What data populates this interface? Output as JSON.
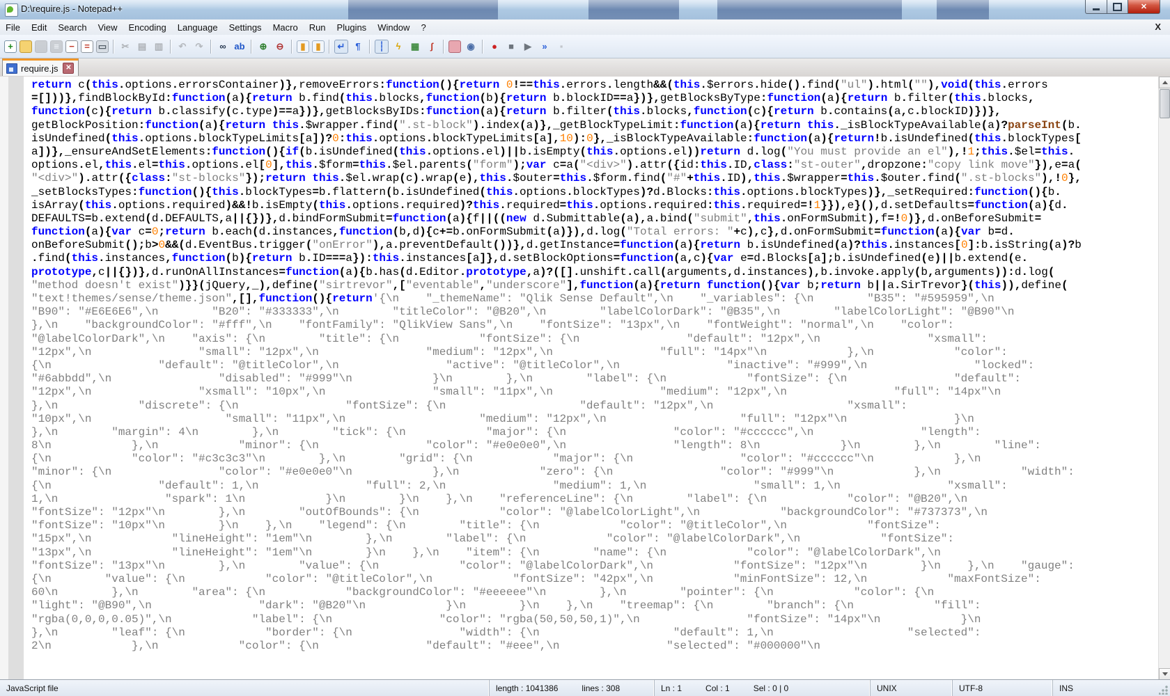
{
  "window": {
    "title": "D:\\require.js - Notepad++",
    "controls": {
      "minimize": "minimize",
      "maximize": "maximize",
      "close": "close"
    }
  },
  "menu": {
    "items": [
      "File",
      "Edit",
      "Search",
      "View",
      "Encoding",
      "Language",
      "Settings",
      "Macro",
      "Run",
      "Plugins",
      "Window",
      "?"
    ],
    "close_label": "X"
  },
  "toolbar": {
    "icons": [
      {
        "name": "new-file-button",
        "glyph": "+",
        "fg": "#1d8a1d",
        "bg": "#ffffff",
        "border": "#7a93a8"
      },
      {
        "name": "open-file-button",
        "glyph": "",
        "fg": "#6b5310",
        "bg": "#f5d271",
        "border": "#c19a35"
      },
      {
        "name": "save-file-button",
        "glyph": "",
        "fg": "#ffffff",
        "bg": "#a9afb6",
        "border": "#8d949c",
        "disabled": true
      },
      {
        "name": "save-all-button",
        "glyph": "≡",
        "fg": "#ffffff",
        "bg": "#a9afb6",
        "border": "#8d949c",
        "disabled": true
      },
      {
        "name": "close-file-button",
        "glyph": "−",
        "fg": "#c23b2a",
        "bg": "#ffffff",
        "border": "#8d949c"
      },
      {
        "name": "close-all-button",
        "glyph": "=",
        "fg": "#c23b2a",
        "bg": "#ffffff",
        "border": "#8d949c"
      },
      {
        "name": "print-button",
        "glyph": "▭",
        "fg": "#555f69",
        "bg": "#d7dde4",
        "border": "#9aa2ab",
        "sep_after": true
      },
      {
        "name": "cut-button",
        "glyph": "✂",
        "fg": "#6d747c",
        "disabled": true
      },
      {
        "name": "copy-button",
        "glyph": "▤",
        "fg": "#6d747c",
        "disabled": true
      },
      {
        "name": "paste-button",
        "glyph": "▥",
        "fg": "#6d747c",
        "disabled": true,
        "sep_after": true
      },
      {
        "name": "undo-button",
        "glyph": "↶",
        "fg": "#7d858e",
        "disabled": true
      },
      {
        "name": "redo-button",
        "glyph": "↷",
        "fg": "#7d858e",
        "disabled": true,
        "sep_after": true
      },
      {
        "name": "find-button",
        "glyph": "∞",
        "fg": "#24354d"
      },
      {
        "name": "replace-button",
        "glyph": "ab",
        "fg": "#1f56c9",
        "sep_after": true
      },
      {
        "name": "zoom-in-button",
        "glyph": "⊕",
        "fg": "#2b7d2b"
      },
      {
        "name": "zoom-out-button",
        "glyph": "⊖",
        "fg": "#b03434",
        "sep_after": true
      },
      {
        "name": "sync-vertical-button",
        "glyph": "▮",
        "fg": "#e39a21",
        "bg": "#f2f6fb",
        "border": "#9fb0c4"
      },
      {
        "name": "sync-horizontal-button",
        "glyph": "▮",
        "fg": "#e39a21",
        "bg": "#f2f6fb",
        "border": "#9fb0c4",
        "sep_after": true
      },
      {
        "name": "word-wrap-button",
        "glyph": "↵",
        "fg": "#2b5fd9",
        "pressed": true
      },
      {
        "name": "show-all-chars-button",
        "glyph": "¶",
        "fg": "#2b5fd9",
        "sep_after": true
      },
      {
        "name": "indent-guide-button",
        "glyph": "┆",
        "fg": "#2b5fd9",
        "pressed": true
      },
      {
        "name": "function-list-button",
        "glyph": "ϟ",
        "fg": "#d9a404"
      },
      {
        "name": "document-map-button",
        "glyph": "▦",
        "fg": "#3f8a3f"
      },
      {
        "name": "run-script-button",
        "glyph": "ʃ",
        "fg": "#c03a2b",
        "sep_after": true
      },
      {
        "name": "project-panel-button",
        "glyph": "",
        "fg": "#7c3b44",
        "bg": "#e8a7b0",
        "border": "#b26773"
      },
      {
        "name": "preview-button",
        "glyph": "◉",
        "fg": "#4a6da7",
        "sep_after": true
      },
      {
        "name": "macro-record-button",
        "glyph": "●",
        "fg": "#cc2222"
      },
      {
        "name": "macro-stop-button",
        "glyph": "■",
        "fg": "#6e757d"
      },
      {
        "name": "macro-play-button",
        "glyph": "▶",
        "fg": "#6e757d"
      },
      {
        "name": "macro-run-multiple-button",
        "glyph": "»",
        "fg": "#2b5fd9"
      },
      {
        "name": "macro-save-button",
        "glyph": "▪",
        "fg": "#9aa0a6",
        "disabled": true
      }
    ]
  },
  "tab": {
    "label": "require.js",
    "close_glyph": "✕"
  },
  "editor": {
    "syntax": {
      "keywords": [
        "function",
        "return",
        "this",
        "var",
        "if",
        "new",
        "void",
        "class",
        "prototype"
      ],
      "builtin": "parseInt",
      "colors": {
        "keyword": "#0000ff",
        "string": "#808080",
        "number": "#ff8000",
        "builtin": "#8b4513",
        "default": "#000000"
      }
    },
    "lines": [
      "return c(this.options.errorsContainer)},removeErrors:function(){return 0!==this.errors.length&&(this.$errors.hide().find(\"ul\").html(\"\"),void(this.errors",
      "=[]))},findBlockById:function(a){return b.find(this.blocks,function(b){return b.blockID==a})},getBlocksByType:function(a){return b.filter(this.blocks,",
      "function(c){return b.classify(c.type)==a})},getBlocksByIDs:function(a){return b.filter(this.blocks,function(c){return b.contains(a,c.blockID)})},",
      "getBlockPosition:function(a){return this.$wrapper.find(\".st-block\").index(a)},_getBlockTypeLimit:function(a){return this._isBlockTypeAvailable(a)?parseInt(b.",
      "isUndefined(this.options.blockTypeLimits[a])?0:this.options.blockTypeLimits[a],10):0},_isBlockTypeAvailable:function(a){return!b.isUndefined(this.blockTypes[",
      "a])},_ensureAndSetElements:function(){if(b.isUndefined(this.options.el)||b.isEmpty(this.options.el))return d.log(\"You must provide an el\"),!1;this.$el=this.",
      "options.el,this.el=this.options.el[0],this.$form=this.$el.parents(\"form\");var c=a(\"<div>\").attr({id:this.ID,class:\"st-outer\",dropzone:\"copy link move\"}),e=a(",
      "\"<div>\").attr({class:\"st-blocks\"});return this.$el.wrap(c).wrap(e),this.$outer=this.$form.find(\"#\"+this.ID),this.$wrapper=this.$outer.find(\".st-blocks\"),!0},",
      "_setBlocksTypes:function(){this.blockTypes=b.flattern(b.isUndefined(this.options.blockTypes)?d.Blocks:this.options.blockTypes)},_setRequired:function(){b.",
      "isArray(this.options.required)&&!b.isEmpty(this.options.required)?this.required=this.options.required:this.required=!1}}),e}(),d.setDefaults=function(a){d.",
      "DEFAULTS=b.extend(d.DEFAULTS,a||{})},d.bindFormSubmit=function(a){f||((new d.Submittable(a),a.bind(\"submit\",this.onFormSubmit),f=!0)},d.onBeforeSubmit=",
      "function(a){var c=0;return b.each(d.instances,function(b,d){c+=b.onFormSubmit(a)}),d.log(\"Total errors: \"+c),c},d.onFormSubmit=function(a){var b=d.",
      "onBeforeSubmit();b>0&&(d.EventBus.trigger(\"onError\"),a.preventDefault())},d.getInstance=function(a){return b.isUndefined(a)?this.instances[0]:b.isString(a)?b",
      ".find(this.instances,function(b){return b.ID===a}):this.instances[a]},d.setBlockOptions=function(a,c){var e=d.Blocks[a];b.isUndefined(e)||b.extend(e.",
      "prototype,c||{})},d.runOnAllInstances=function(a){b.has(d.Editor.prototype,a)?([].unshift.call(arguments,d.instances),b.invoke.apply(b,arguments)):d.log(",
      "\"method doesn't exist\")}}(jQuery,_),define(\"sirtrevor\",[\"eventable\",\"underscore\"],function(a){return function(){var b;return b||a.SirTrevor}(this)),define(",
      "\"text!themes/sense/theme.json\",[],function(){return'{\\n    \"_themeName\": \"Qlik Sense Default\",\\n    \"_variables\": {\\n        \"B35\": \"#595959\",\\n",
      "\"B90\": \"#E6E6E6\",\\n        \"B20\": \"#333333\",\\n        \"titleColor\": \"@B20\",\\n        \"labelColorDark\": \"@B35\",\\n        \"labelColorLight\": \"@B90\"\\n",
      "},\\n    \"backgroundColor\": \"#fff\",\\n    \"fontFamily\": \"QlikView Sans\",\\n    \"fontSize\": \"13px\",\\n    \"fontWeight\": \"normal\",\\n    \"color\":",
      "\"@labelColorDark\",\\n    \"axis\": {\\n        \"title\": {\\n            \"fontSize\": {\\n                \"default\": \"12px\",\\n                \"xsmall\":",
      "\"12px\",\\n                \"small\": \"12px\",\\n                \"medium\": \"12px\",\\n                \"full\": \"14px\"\\n            },\\n            \"color\":",
      "{\\n                \"default\": \"@titleColor\",\\n                \"active\": \"@titleColor\",\\n                \"inactive\": \"#999\",\\n                \"locked\":",
      "\"#6abbdd\",\\n                \"disabled\": \"#999\"\\n            }\\n        },\\n        \"label\": {\\n            \"fontSize\": {\\n                \"default\":",
      "\"12px\",\\n                \"xsmall\": \"10px\",\\n                \"small\": \"11px\",\\n                \"medium\": \"12px\",\\n                \"full\": \"14px\"\\n",
      "},\\n            \"discrete\": {\\n                \"fontSize\": {\\n                    \"default\": \"12px\",\\n                    \"xsmall\":",
      "\"10px\",\\n                    \"small\": \"11px\",\\n                    \"medium\": \"12px\",\\n                    \"full\": \"12px\"\\n                }\\n",
      "},\\n        \"margin\": 4\\n        },\\n        \"tick\": {\\n            \"major\": {\\n                \"color\": \"#cccccc\",\\n                \"length\":",
      "8\\n            },\\n            \"minor\": {\\n                \"color\": \"#e0e0e0\",\\n                \"length\": 8\\n            }\\n        },\\n        \"line\":",
      "{\\n            \"color\": \"#c3c3c3\"\\n        },\\n        \"grid\": {\\n            \"major\": {\\n                \"color\": \"#cccccc\"\\n            },\\n",
      "\"minor\": {\\n                \"color\": \"#e0e0e0\"\\n            },\\n            \"zero\": {\\n                \"color\": \"#999\"\\n            },\\n            \"width\":",
      "{\\n                \"default\": 1,\\n                \"full\": 2,\\n                \"medium\": 1,\\n                \"small\": 1,\\n                \"xsmall\":",
      "1,\\n                \"spark\": 1\\n            }\\n        }\\n    },\\n    \"referenceLine\": {\\n        \"label\": {\\n            \"color\": \"@B20\",\\n",
      "\"fontSize\": \"12px\"\\n        },\\n        \"outOfBounds\": {\\n            \"color\": \"@labelColorLight\",\\n            \"backgroundColor\": \"#737373\",\\n",
      "\"fontSize\": \"10px\"\\n        }\\n    },\\n    \"legend\": {\\n        \"title\": {\\n            \"color\": \"@titleColor\",\\n            \"fontSize\":",
      "\"15px\",\\n            \"lineHeight\": \"1em\"\\n        },\\n        \"label\": {\\n            \"color\": \"@labelColorDark\",\\n            \"fontSize\":",
      "\"13px\",\\n            \"lineHeight\": \"1em\"\\n        }\\n    },\\n    \"item\": {\\n        \"name\": {\\n            \"color\": \"@labelColorDark\",\\n",
      "\"fontSize\": \"13px\"\\n        },\\n        \"value\": {\\n            \"color\": \"@labelColorDark\",\\n            \"fontSize\": \"12px\"\\n        }\\n    },\\n    \"gauge\":",
      "{\\n        \"value\": {\\n            \"color\": \"@titleColor\",\\n            \"fontSize\": \"42px\",\\n            \"minFontSize\": 12,\\n            \"maxFontSize\":",
      "60\\n        },\\n        \"area\": {\\n            \"backgroundColor\": \"#eeeeee\"\\n        },\\n        \"pointer\": {\\n            \"color\": {\\n",
      "\"light\": \"@B90\",\\n                \"dark\": \"@B20\"\\n            }\\n        }\\n    },\\n    \"treemap\": {\\n        \"branch\": {\\n            \"fill\":",
      "\"rgba(0,0,0,0.05)\",\\n            \"label\": {\\n                \"color\": \"rgba(50,50,50,1)\",\\n                \"fontSize\": \"14px\"\\n            }\\n",
      "},\\n        \"leaf\": {\\n            \"border\": {\\n                \"width\": {\\n                    \"default\": 1,\\n                    \"selected\":",
      "2\\n            },\\n            \"color\": {\\n                \"default\": \"#eee\",\\n                \"selected\": \"#000000\"\\n"
    ]
  },
  "status_bar": {
    "doc_type": "JavaScript file",
    "length": "length : 1041386",
    "lines": "lines : 308",
    "ln": "Ln : 1",
    "col": "Col : 1",
    "sel": "Sel : 0 | 0",
    "eol": "UNIX",
    "encoding": "UTF-8",
    "mode": "INS"
  }
}
